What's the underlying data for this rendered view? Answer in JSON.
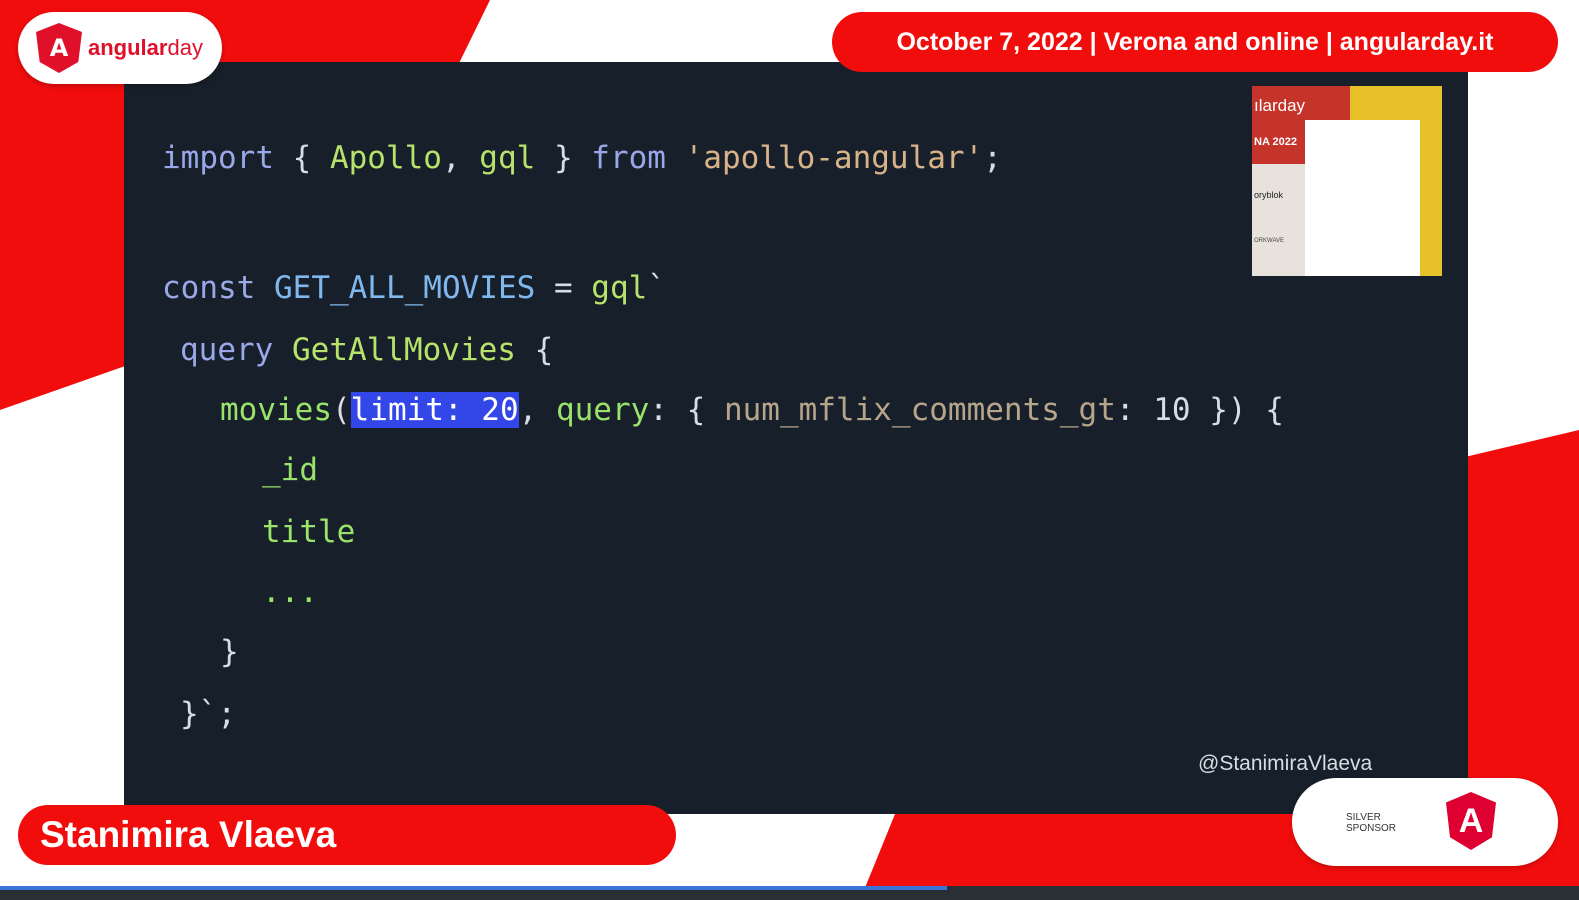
{
  "logo": {
    "mark": "A",
    "text_bold": "angular",
    "text_light": "day"
  },
  "header": {
    "event_info": "October 7, 2022 | Verona and online | angularday.it"
  },
  "code": {
    "line1": {
      "import": "import",
      "brace_open": " { ",
      "apollo": "Apollo",
      "comma": ", ",
      "gql": "gql",
      "brace_close": " } ",
      "from": "from",
      "module": " 'apollo-angular'",
      "semi": ";"
    },
    "line2": {
      "const": "const",
      "name": " GET_ALL_MOVIES",
      "eq": " = ",
      "gql": "gql",
      "tick": "`"
    },
    "line3": {
      "query": "query",
      "name": " GetAllMovies",
      "brace": " {"
    },
    "line4": {
      "movies": "movies",
      "paren": "(",
      "highlight": "limit: 20",
      "comma": ", ",
      "query": "query",
      "colon": ": { ",
      "field": "num_mflix_comments_gt",
      "colon2": ": ",
      "num": "10",
      "end": " }) {"
    },
    "line5": "_id",
    "line6": "title",
    "line7": "...",
    "line8": "}",
    "line9": "}`;"
  },
  "webcam": {
    "brand": "ılarday",
    "year": "NA 2022",
    "sponsor1": "oryblok",
    "sponsor2": "ORKWAVE"
  },
  "handle": "@StanimiraVlaeva",
  "speaker": {
    "name": "Stanimira Vlaeva"
  },
  "sponsor": {
    "label": "SILVER SPONSOR",
    "logo_letter": "A"
  },
  "progress": {
    "fraction": 0.6
  },
  "colors": {
    "brand_red": "#f20d0d",
    "slide_bg": "#17202a",
    "highlight": "#3346e8"
  }
}
